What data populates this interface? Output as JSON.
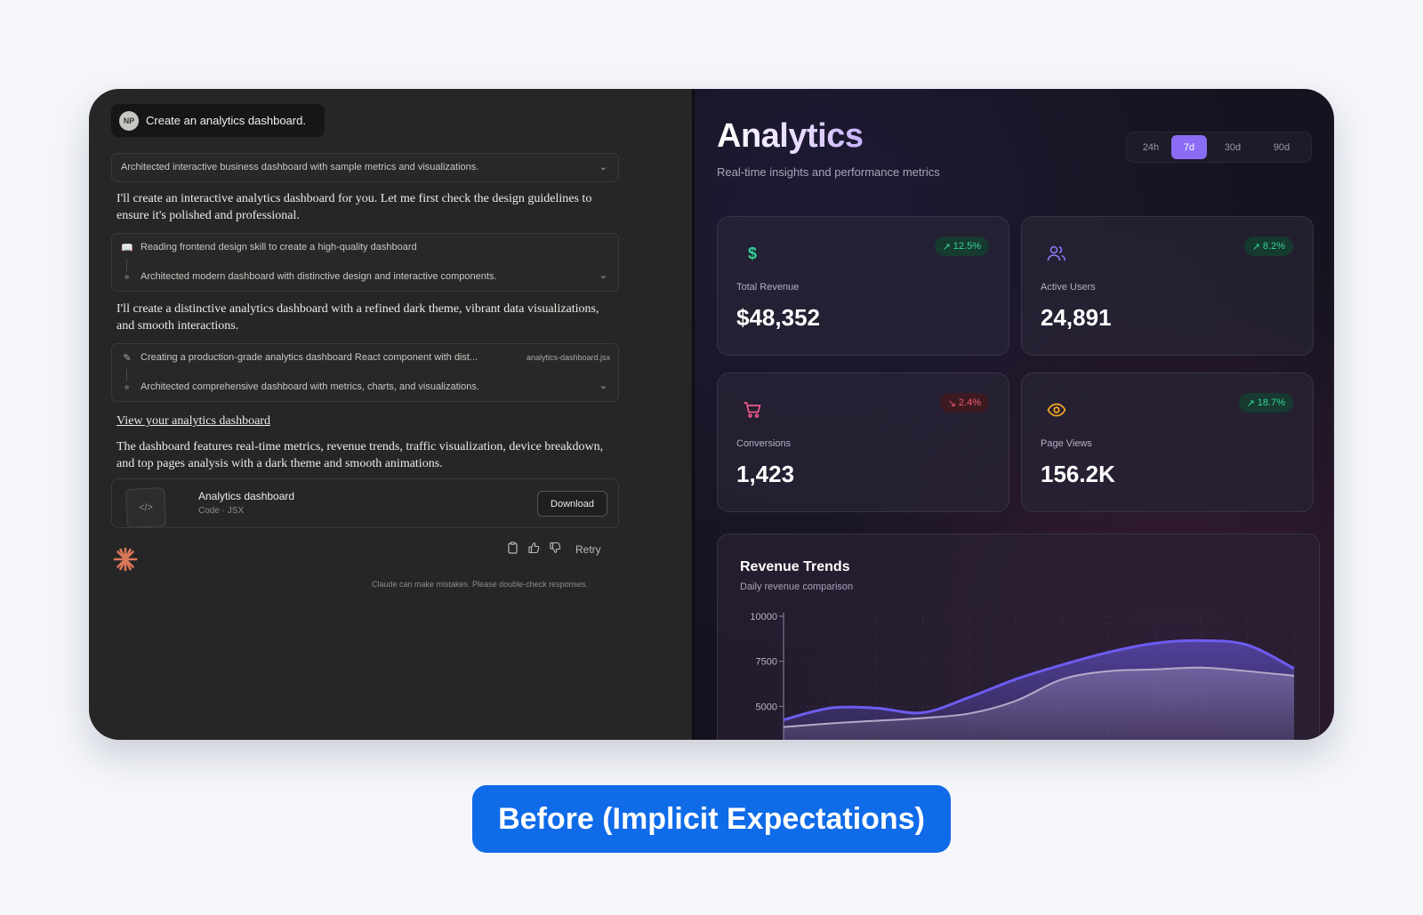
{
  "chat": {
    "user": {
      "initials": "NP",
      "message": "Create an analytics dashboard."
    },
    "summary_1": "Architected interactive business dashboard with sample metrics and visualizations.",
    "para_1": "I'll create an interactive analytics dashboard for you. Let me first check the design guidelines to ensure it's polished and professional.",
    "step_1": {
      "action": "Reading frontend design skill to create a high-quality dashboard",
      "result": "Architected modern dashboard with distinctive design and interactive components."
    },
    "para_2": "I'll create a distinctive analytics dashboard with a refined dark theme, vibrant data visualizations, and smooth interactions.",
    "step_2": {
      "action": "Creating a production-grade analytics dashboard React component with dist...",
      "file": "analytics-dashboard.jsx",
      "result": "Architected comprehensive dashboard with metrics, charts, and visualizations."
    },
    "link_text": "View your analytics dashboard",
    "para_3": "The dashboard features real-time metrics, revenue trends, traffic visualization, device breakdown, and top pages analysis with a dark theme and smooth animations.",
    "artifact": {
      "title": "Analytics dashboard",
      "subtitle": "Code · JSX",
      "download_label": "Download"
    },
    "actions": {
      "retry_label": "Retry"
    },
    "disclaimer": "Claude can make mistakes. Please double-check responses."
  },
  "dashboard": {
    "title": "Analytics",
    "subtitle": "Real-time insights and performance metrics",
    "ranges": [
      "24h",
      "7d",
      "30d",
      "90d"
    ],
    "active_range": "7d",
    "cards": [
      {
        "label": "Total Revenue",
        "value": "$48,352",
        "change": "12.5%",
        "trend": "up",
        "icon": "dollar-icon",
        "icon_color": "#34d399"
      },
      {
        "label": "Active Users",
        "value": "24,891",
        "change": "8.2%",
        "trend": "up",
        "icon": "users-icon",
        "icon_color": "#8b7cf6"
      },
      {
        "label": "Conversions",
        "value": "1,423",
        "change": "2.4%",
        "trend": "down",
        "icon": "cart-icon",
        "icon_color": "#f05a8a"
      },
      {
        "label": "Page Views",
        "value": "156.2K",
        "change": "18.7%",
        "trend": "up",
        "icon": "eye-icon",
        "icon_color": "#f5a524"
      }
    ],
    "chart": {
      "title": "Revenue Trends",
      "subtitle": "Daily revenue comparison"
    }
  },
  "caption": "Before (Implicit Expectations)",
  "chart_data": {
    "type": "area",
    "title": "Revenue Trends",
    "subtitle": "Daily revenue comparison",
    "xlabel": "",
    "ylabel": "",
    "ylim": [
      2500,
      10000
    ],
    "yticks": [
      10000,
      7500,
      5000
    ],
    "x": [
      0,
      1,
      2,
      3,
      4,
      5,
      6,
      7,
      8,
      9,
      10,
      11
    ],
    "series": [
      {
        "values": [
          4250,
          4900,
          4900,
          4650,
          5500,
          6500,
          7300,
          8000,
          8500,
          8650,
          8400,
          7100
        ],
        "color": "#6d5cf0"
      },
      {
        "values": [
          3850,
          4050,
          4200,
          4350,
          4600,
          5300,
          6500,
          6950,
          7050,
          7150,
          6950,
          6700
        ],
        "color": "#b7a9c9"
      }
    ],
    "grid": true
  }
}
